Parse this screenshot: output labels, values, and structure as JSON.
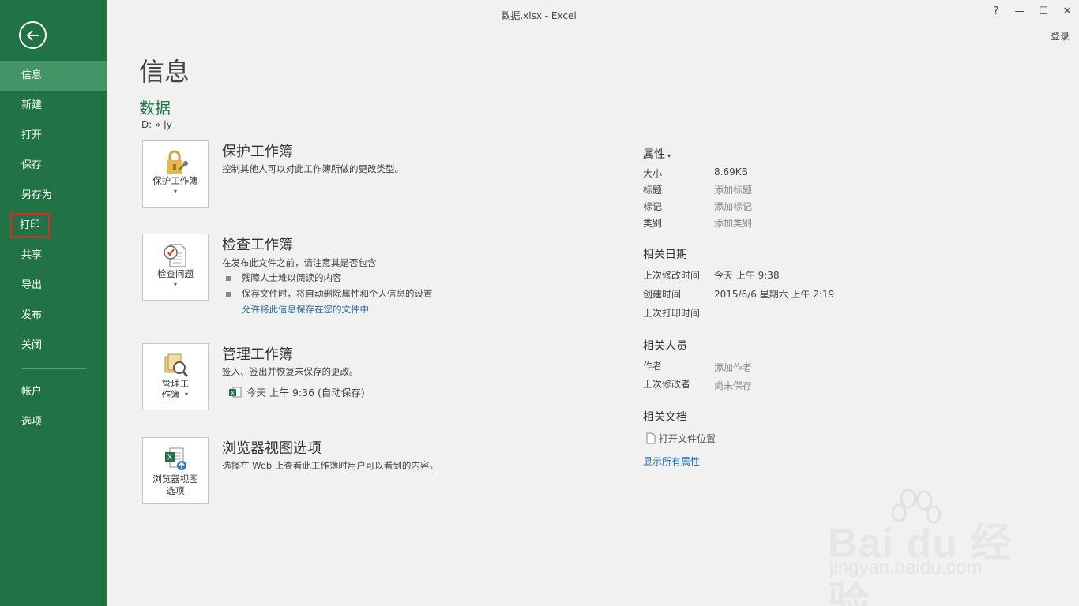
{
  "window": {
    "title": "数据.xlsx - Excel",
    "help": "?",
    "minimize": "—",
    "maximize": "☐",
    "close": "✕",
    "login": "登录"
  },
  "sidebar": {
    "items": [
      {
        "label": "信息"
      },
      {
        "label": "新建"
      },
      {
        "label": "打开"
      },
      {
        "label": "保存"
      },
      {
        "label": "另存为"
      },
      {
        "label": "打印"
      },
      {
        "label": "共享"
      },
      {
        "label": "导出"
      },
      {
        "label": "发布"
      },
      {
        "label": "关闭"
      },
      {
        "label": "帐户"
      },
      {
        "label": "选项"
      }
    ]
  },
  "main": {
    "title": "信息",
    "doc_name": "数据",
    "doc_path": "D: » jy",
    "sections": [
      {
        "button": "保护工作簿",
        "title": "保护工作簿",
        "desc": "控制其他人可以对此工作簿所做的更改类型。"
      },
      {
        "button": "检查问题",
        "title": "检查工作簿",
        "desc": "在发布此文件之前，请注意其是否包含:",
        "bullets": [
          "残障人士难以阅读的内容",
          "保存文件时，将自动删除属性和个人信息的设置"
        ],
        "link": "允许将此信息保存在您的文件中"
      },
      {
        "button_line1": "管理工",
        "button_line2": "作簿",
        "title": "管理工作簿",
        "desc": "签入、签出并恢复未保存的更改。",
        "version": "今天 上午 9:36 (自动保存)"
      },
      {
        "button_line1": "浏览器视图",
        "button_line2": "选项",
        "title": "浏览器视图选项",
        "desc": "选择在 Web 上查看此工作簿时用户可以看到的内容。"
      }
    ]
  },
  "properties": {
    "heading": "属性",
    "rows": [
      {
        "label": "大小",
        "value": "8.69KB"
      },
      {
        "label": "标题",
        "value": "添加标题"
      },
      {
        "label": "标记",
        "value": "添加标记"
      },
      {
        "label": "类别",
        "value": "添加类别"
      }
    ],
    "dates_heading": "相关日期",
    "dates": [
      {
        "label": "上次修改时间",
        "value": "今天 上午 9:38"
      },
      {
        "label": "创建时间",
        "value": "2015/6/6 星期六 上午 2:19"
      },
      {
        "label": "上次打印时间",
        "value": ""
      }
    ],
    "people_heading": "相关人员",
    "people": [
      {
        "label": "作者",
        "value": "添加作者"
      },
      {
        "label": "上次修改者",
        "value": "尚未保存"
      }
    ],
    "docs_heading": "相关文档",
    "open_location": "打开文件位置",
    "show_all": "显示所有属性"
  },
  "watermark": {
    "logo": "Bai du 经验",
    "url": "jingyan.baidu.com"
  },
  "colors": {
    "accent": "#217346",
    "active": "#439467",
    "link": "#1e6bb0",
    "highlight": "#e0281c"
  }
}
